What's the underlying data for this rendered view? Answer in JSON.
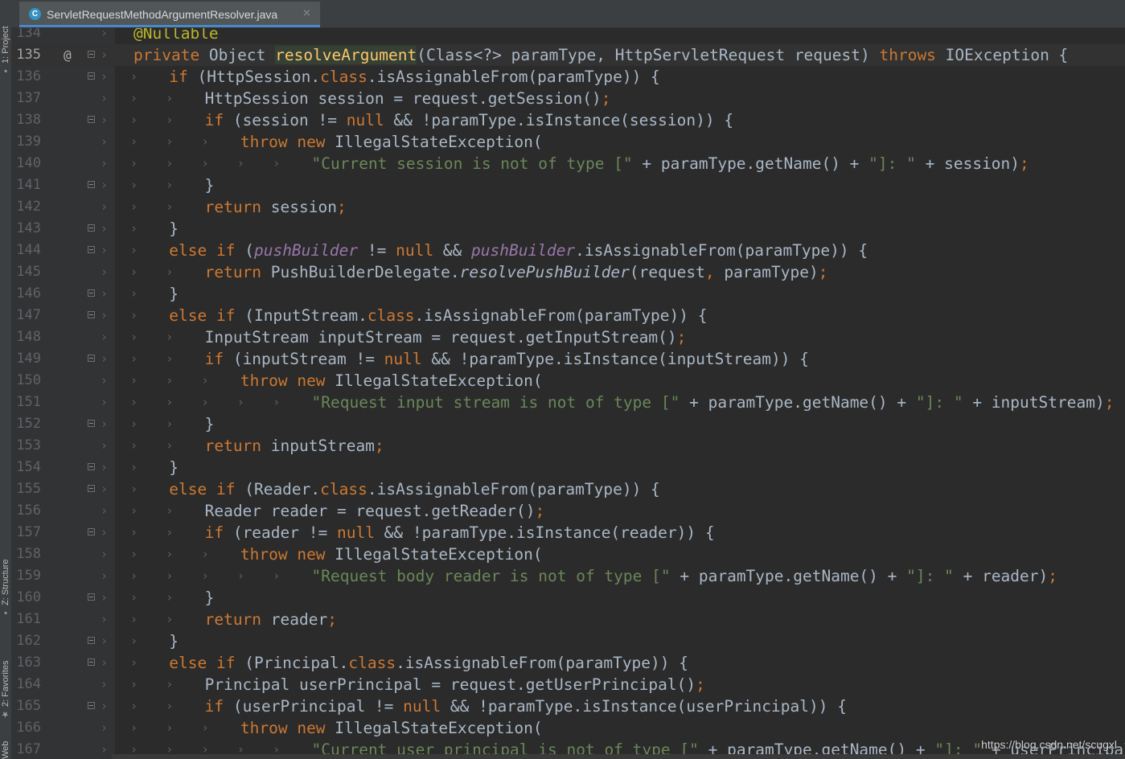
{
  "editor_tab": {
    "file_icon": "java-class-icon",
    "file_icon_glyph": "C",
    "title": "ServletRequestMethodArgumentResolver.java",
    "close_glyph": "×"
  },
  "tool_windows": {
    "project": "1: Project",
    "structure": "Z: Structure",
    "favorites": "2: Favorites",
    "web": "Web"
  },
  "current_line": "135",
  "colors": {
    "background": "#2b2b2b",
    "keyword": "#cc7832",
    "string": "#6a8759",
    "method_declaration": "#ffc66d",
    "annotation": "#bbb529",
    "field": "#9876aa",
    "default_text": "#a9b7c6"
  },
  "code_lines": [
    {
      "n": "134",
      "indent": 1,
      "fold": false,
      "tokens": [
        [
          "a",
          "@Nullable"
        ]
      ]
    },
    {
      "n": "135",
      "indent": 1,
      "fold": true,
      "override": true,
      "tokens": [
        [
          "k",
          "private "
        ],
        [
          "p",
          "Object "
        ],
        [
          "m",
          "resolveArgument"
        ],
        [
          "p",
          "(Class<?> paramType, HttpServletRequest request) "
        ],
        [
          "k",
          "throws "
        ],
        [
          "p",
          "IOException {"
        ]
      ]
    },
    {
      "n": "136",
      "indent": 2,
      "fold": true,
      "tokens": [
        [
          "k",
          "if "
        ],
        [
          "p",
          "(HttpSession."
        ],
        [
          "k",
          "class"
        ],
        [
          "p",
          ".isAssignableFrom(paramType)) {"
        ]
      ]
    },
    {
      "n": "137",
      "indent": 3,
      "fold": false,
      "tokens": [
        [
          "p",
          "HttpSession session = request.getSession()"
        ],
        [
          "k",
          ";"
        ]
      ]
    },
    {
      "n": "138",
      "indent": 3,
      "fold": true,
      "tokens": [
        [
          "k",
          "if "
        ],
        [
          "p",
          "(session != "
        ],
        [
          "k",
          "null "
        ],
        [
          "p",
          "&& !paramType.isInstance(session)) {"
        ]
      ]
    },
    {
      "n": "139",
      "indent": 4,
      "fold": false,
      "tokens": [
        [
          "k",
          "throw new "
        ],
        [
          "p",
          "IllegalStateException("
        ]
      ]
    },
    {
      "n": "140",
      "indent": 6,
      "fold": false,
      "tokens": [
        [
          "s",
          "\"Current session is not of type [\" "
        ],
        [
          "p",
          "+ paramType.getName() + "
        ],
        [
          "s",
          "\"]: \" "
        ],
        [
          "p",
          "+ session)"
        ],
        [
          "k",
          ";"
        ]
      ]
    },
    {
      "n": "141",
      "indent": 3,
      "fold": true,
      "tokens": [
        [
          "p",
          "}"
        ]
      ]
    },
    {
      "n": "142",
      "indent": 3,
      "fold": false,
      "tokens": [
        [
          "k",
          "return "
        ],
        [
          "p",
          "session"
        ],
        [
          "k",
          ";"
        ]
      ]
    },
    {
      "n": "143",
      "indent": 2,
      "fold": true,
      "tokens": [
        [
          "p",
          "}"
        ]
      ]
    },
    {
      "n": "144",
      "indent": 2,
      "fold": true,
      "tokens": [
        [
          "k",
          "else if "
        ],
        [
          "p",
          "("
        ],
        [
          "f",
          "pushBuilder "
        ],
        [
          "p",
          "!= "
        ],
        [
          "k",
          "null "
        ],
        [
          "p",
          "&& "
        ],
        [
          "f",
          "pushBuilder"
        ],
        [
          "p",
          ".isAssignableFrom(paramType)) {"
        ]
      ]
    },
    {
      "n": "145",
      "indent": 3,
      "fold": false,
      "tokens": [
        [
          "k",
          "return "
        ],
        [
          "p",
          "PushBuilderDelegate."
        ],
        [
          "i",
          "resolvePushBuilder"
        ],
        [
          "p",
          "(request"
        ],
        [
          "k",
          ", "
        ],
        [
          "p",
          "paramType)"
        ],
        [
          "k",
          ";"
        ]
      ]
    },
    {
      "n": "146",
      "indent": 2,
      "fold": true,
      "tokens": [
        [
          "p",
          "}"
        ]
      ]
    },
    {
      "n": "147",
      "indent": 2,
      "fold": true,
      "tokens": [
        [
          "k",
          "else if "
        ],
        [
          "p",
          "(InputStream."
        ],
        [
          "k",
          "class"
        ],
        [
          "p",
          ".isAssignableFrom(paramType)) {"
        ]
      ]
    },
    {
      "n": "148",
      "indent": 3,
      "fold": false,
      "tokens": [
        [
          "p",
          "InputStream inputStream = request.getInputStream()"
        ],
        [
          "k",
          ";"
        ]
      ]
    },
    {
      "n": "149",
      "indent": 3,
      "fold": true,
      "tokens": [
        [
          "k",
          "if "
        ],
        [
          "p",
          "(inputStream != "
        ],
        [
          "k",
          "null "
        ],
        [
          "p",
          "&& !paramType.isInstance(inputStream)) {"
        ]
      ]
    },
    {
      "n": "150",
      "indent": 4,
      "fold": false,
      "tokens": [
        [
          "k",
          "throw new "
        ],
        [
          "p",
          "IllegalStateException("
        ]
      ]
    },
    {
      "n": "151",
      "indent": 6,
      "fold": false,
      "tokens": [
        [
          "s",
          "\"Request input stream is not of type [\" "
        ],
        [
          "p",
          "+ paramType.getName() + "
        ],
        [
          "s",
          "\"]: \" "
        ],
        [
          "p",
          "+ inputStream)"
        ],
        [
          "k",
          ";"
        ]
      ]
    },
    {
      "n": "152",
      "indent": 3,
      "fold": true,
      "tokens": [
        [
          "p",
          "}"
        ]
      ]
    },
    {
      "n": "153",
      "indent": 3,
      "fold": false,
      "tokens": [
        [
          "k",
          "return "
        ],
        [
          "p",
          "inputStream"
        ],
        [
          "k",
          ";"
        ]
      ]
    },
    {
      "n": "154",
      "indent": 2,
      "fold": true,
      "tokens": [
        [
          "p",
          "}"
        ]
      ]
    },
    {
      "n": "155",
      "indent": 2,
      "fold": true,
      "tokens": [
        [
          "k",
          "else if "
        ],
        [
          "p",
          "(Reader."
        ],
        [
          "k",
          "class"
        ],
        [
          "p",
          ".isAssignableFrom(paramType)) {"
        ]
      ]
    },
    {
      "n": "156",
      "indent": 3,
      "fold": false,
      "tokens": [
        [
          "p",
          "Reader reader = request.getReader()"
        ],
        [
          "k",
          ";"
        ]
      ]
    },
    {
      "n": "157",
      "indent": 3,
      "fold": true,
      "tokens": [
        [
          "k",
          "if "
        ],
        [
          "p",
          "(reader != "
        ],
        [
          "k",
          "null "
        ],
        [
          "p",
          "&& !paramType.isInstance(reader)) {"
        ]
      ]
    },
    {
      "n": "158",
      "indent": 4,
      "fold": false,
      "tokens": [
        [
          "k",
          "throw new "
        ],
        [
          "p",
          "IllegalStateException("
        ]
      ]
    },
    {
      "n": "159",
      "indent": 6,
      "fold": false,
      "tokens": [
        [
          "s",
          "\"Request body reader is not of type [\" "
        ],
        [
          "p",
          "+ paramType.getName() + "
        ],
        [
          "s",
          "\"]: \" "
        ],
        [
          "p",
          "+ reader)"
        ],
        [
          "k",
          ";"
        ]
      ]
    },
    {
      "n": "160",
      "indent": 3,
      "fold": true,
      "tokens": [
        [
          "p",
          "}"
        ]
      ]
    },
    {
      "n": "161",
      "indent": 3,
      "fold": false,
      "tokens": [
        [
          "k",
          "return "
        ],
        [
          "p",
          "reader"
        ],
        [
          "k",
          ";"
        ]
      ]
    },
    {
      "n": "162",
      "indent": 2,
      "fold": true,
      "tokens": [
        [
          "p",
          "}"
        ]
      ]
    },
    {
      "n": "163",
      "indent": 2,
      "fold": true,
      "tokens": [
        [
          "k",
          "else if "
        ],
        [
          "p",
          "(Principal."
        ],
        [
          "k",
          "class"
        ],
        [
          "p",
          ".isAssignableFrom(paramType)) {"
        ]
      ]
    },
    {
      "n": "164",
      "indent": 3,
      "fold": false,
      "tokens": [
        [
          "p",
          "Principal userPrincipal = request.getUserPrincipal()"
        ],
        [
          "k",
          ";"
        ]
      ]
    },
    {
      "n": "165",
      "indent": 3,
      "fold": true,
      "tokens": [
        [
          "k",
          "if "
        ],
        [
          "p",
          "(userPrincipal != "
        ],
        [
          "k",
          "null "
        ],
        [
          "p",
          "&& !paramType.isInstance(userPrincipal)) {"
        ]
      ]
    },
    {
      "n": "166",
      "indent": 4,
      "fold": false,
      "tokens": [
        [
          "k",
          "throw new "
        ],
        [
          "p",
          "IllegalStateException("
        ]
      ]
    },
    {
      "n": "167",
      "indent": 6,
      "fold": false,
      "tokens": [
        [
          "s",
          "\"Current user principal is not of type [\" "
        ],
        [
          "p",
          "+ paramType.getName() + "
        ],
        [
          "s",
          "\"]: \" "
        ],
        [
          "p",
          "+ userPrincipal)"
        ],
        [
          "k",
          ";"
        ]
      ]
    }
  ],
  "watermark": "https://blog.csdn.net/scugxl"
}
